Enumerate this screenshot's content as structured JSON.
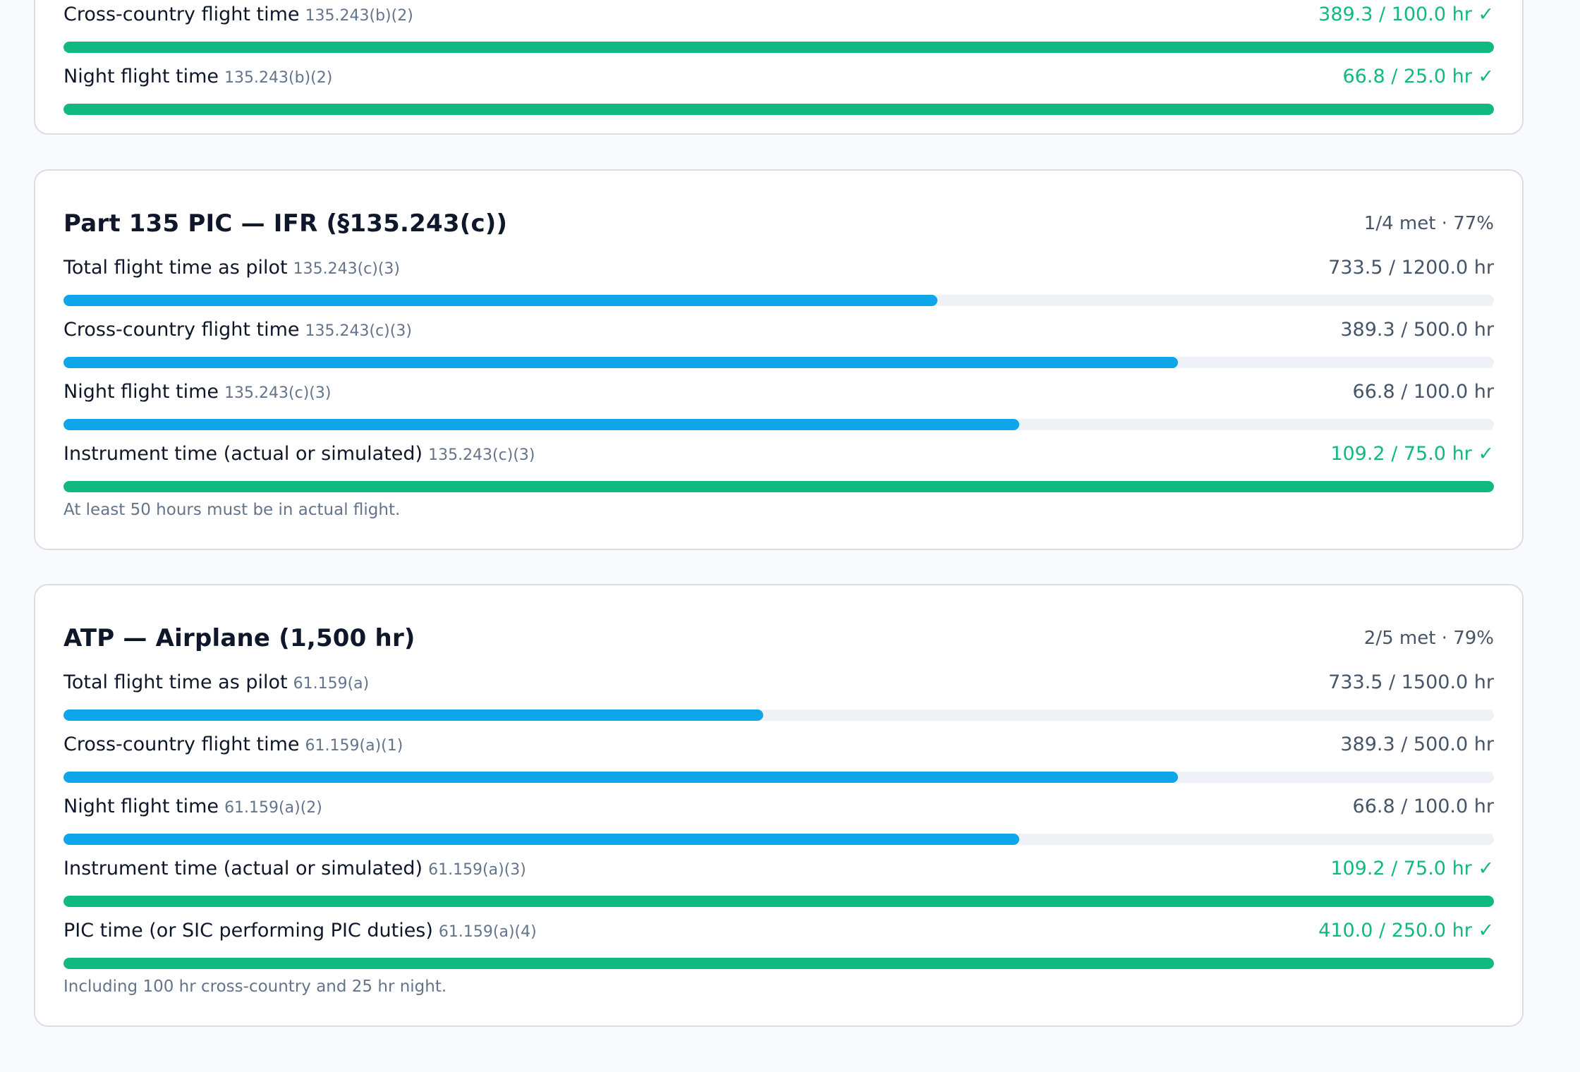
{
  "colors": {
    "met": "#10b981",
    "progress": "#0ea5e9",
    "track": "#eef2f7",
    "card_border": "#d9dee6",
    "background": "#f8fafc"
  },
  "cards": [
    {
      "title": "",
      "summary": "",
      "note": "",
      "requirements": [
        {
          "label": "Cross-country flight time",
          "ref": "135.243(b)(2)",
          "value": "389.3 / 100.0 hr ✓",
          "progress": 1.0,
          "met": true
        },
        {
          "label": "Night flight time",
          "ref": "135.243(b)(2)",
          "value": "66.8 / 25.0 hr ✓",
          "progress": 1.0,
          "met": true
        }
      ]
    },
    {
      "title": "Part 135 PIC — IFR (§135.243(c))",
      "summary": "1/4 met · 77%",
      "note": "At least 50 hours must be in actual flight.",
      "requirements": [
        {
          "label": "Total flight time as pilot",
          "ref": "135.243(c)(3)",
          "value": "733.5 / 1200.0 hr",
          "progress": 0.611,
          "met": false
        },
        {
          "label": "Cross-country flight time",
          "ref": "135.243(c)(3)",
          "value": "389.3 / 500.0 hr",
          "progress": 0.779,
          "met": false
        },
        {
          "label": "Night flight time",
          "ref": "135.243(c)(3)",
          "value": "66.8 / 100.0 hr",
          "progress": 0.668,
          "met": false
        },
        {
          "label": "Instrument time (actual or simulated)",
          "ref": "135.243(c)(3)",
          "value": "109.2 / 75.0 hr ✓",
          "progress": 1.0,
          "met": true
        }
      ]
    },
    {
      "title": "ATP — Airplane (1,500 hr)",
      "summary": "2/5 met · 79%",
      "note": "Including 100 hr cross-country and 25 hr night.",
      "requirements": [
        {
          "label": "Total flight time as pilot",
          "ref": "61.159(a)",
          "value": "733.5 / 1500.0 hr",
          "progress": 0.489,
          "met": false
        },
        {
          "label": "Cross-country flight time",
          "ref": "61.159(a)(1)",
          "value": "389.3 / 500.0 hr",
          "progress": 0.779,
          "met": false
        },
        {
          "label": "Night flight time",
          "ref": "61.159(a)(2)",
          "value": "66.8 / 100.0 hr",
          "progress": 0.668,
          "met": false
        },
        {
          "label": "Instrument time (actual or simulated)",
          "ref": "61.159(a)(3)",
          "value": "109.2 / 75.0 hr ✓",
          "progress": 1.0,
          "met": true
        },
        {
          "label": "PIC time (or SIC performing PIC duties)",
          "ref": "61.159(a)(4)",
          "value": "410.0 / 250.0 hr ✓",
          "progress": 1.0,
          "met": true
        }
      ]
    }
  ]
}
